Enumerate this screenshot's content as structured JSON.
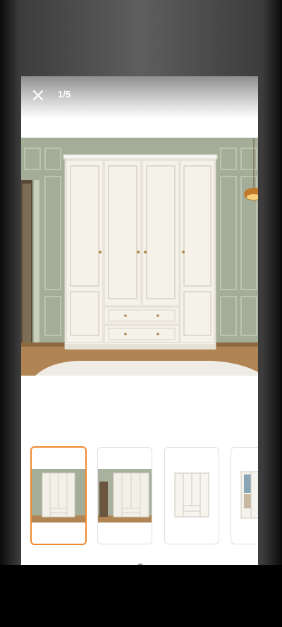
{
  "viewer": {
    "counter": "1/5",
    "current_index": 1,
    "total": 5
  },
  "icons": {
    "close": "close-icon"
  },
  "colors": {
    "active_thumb_border": "#f0882c",
    "wall": "#a3ad98",
    "wardrobe": "#f3f0e8"
  },
  "thumbnails": [
    {
      "name": "thumbnail-1",
      "active": true
    },
    {
      "name": "thumbnail-2",
      "active": false
    },
    {
      "name": "thumbnail-3",
      "active": false
    },
    {
      "name": "thumbnail-4",
      "active": false
    }
  ]
}
